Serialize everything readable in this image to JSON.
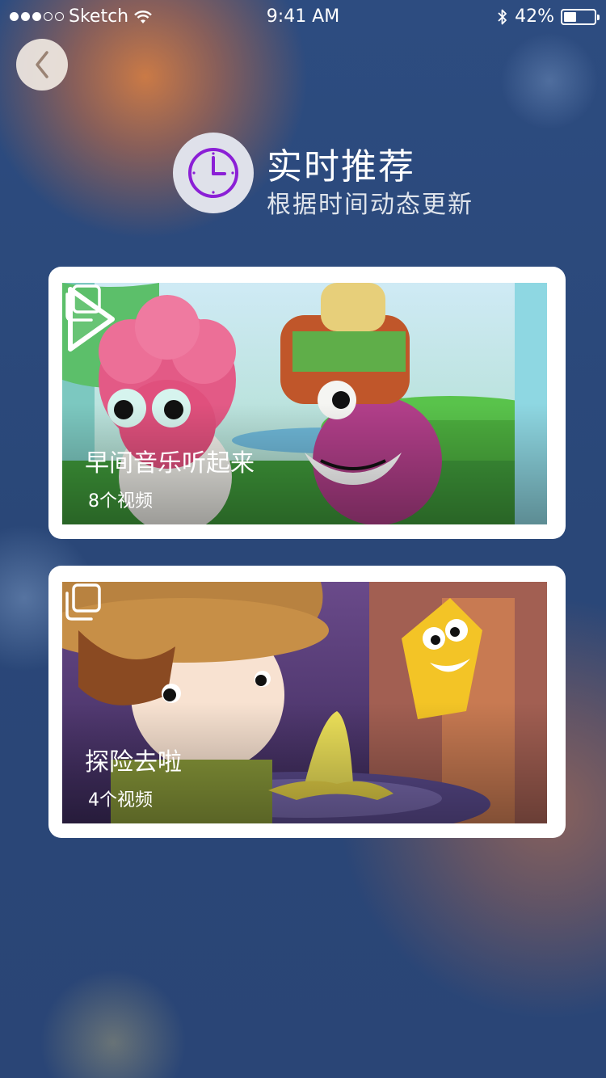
{
  "status_bar": {
    "carrier": "Sketch",
    "time": "9:41 AM",
    "battery_percent": "42%",
    "signal_bars": 3,
    "signal_total": 5,
    "battery_level": 0.42
  },
  "header": {
    "title": "实时推荐",
    "subtitle": "根据时间动态更新",
    "icon": "clock-icon",
    "icon_color": "#8b1fd6"
  },
  "cards": [
    {
      "title": "早间音乐听起来",
      "count": "8个视频",
      "has_play": true
    },
    {
      "title": "探险去啦",
      "count": "4个视频",
      "has_play": false
    }
  ],
  "colors": {
    "background": "#2c4a7c",
    "card": "#ffffff",
    "accent": "#8b1fd6"
  }
}
